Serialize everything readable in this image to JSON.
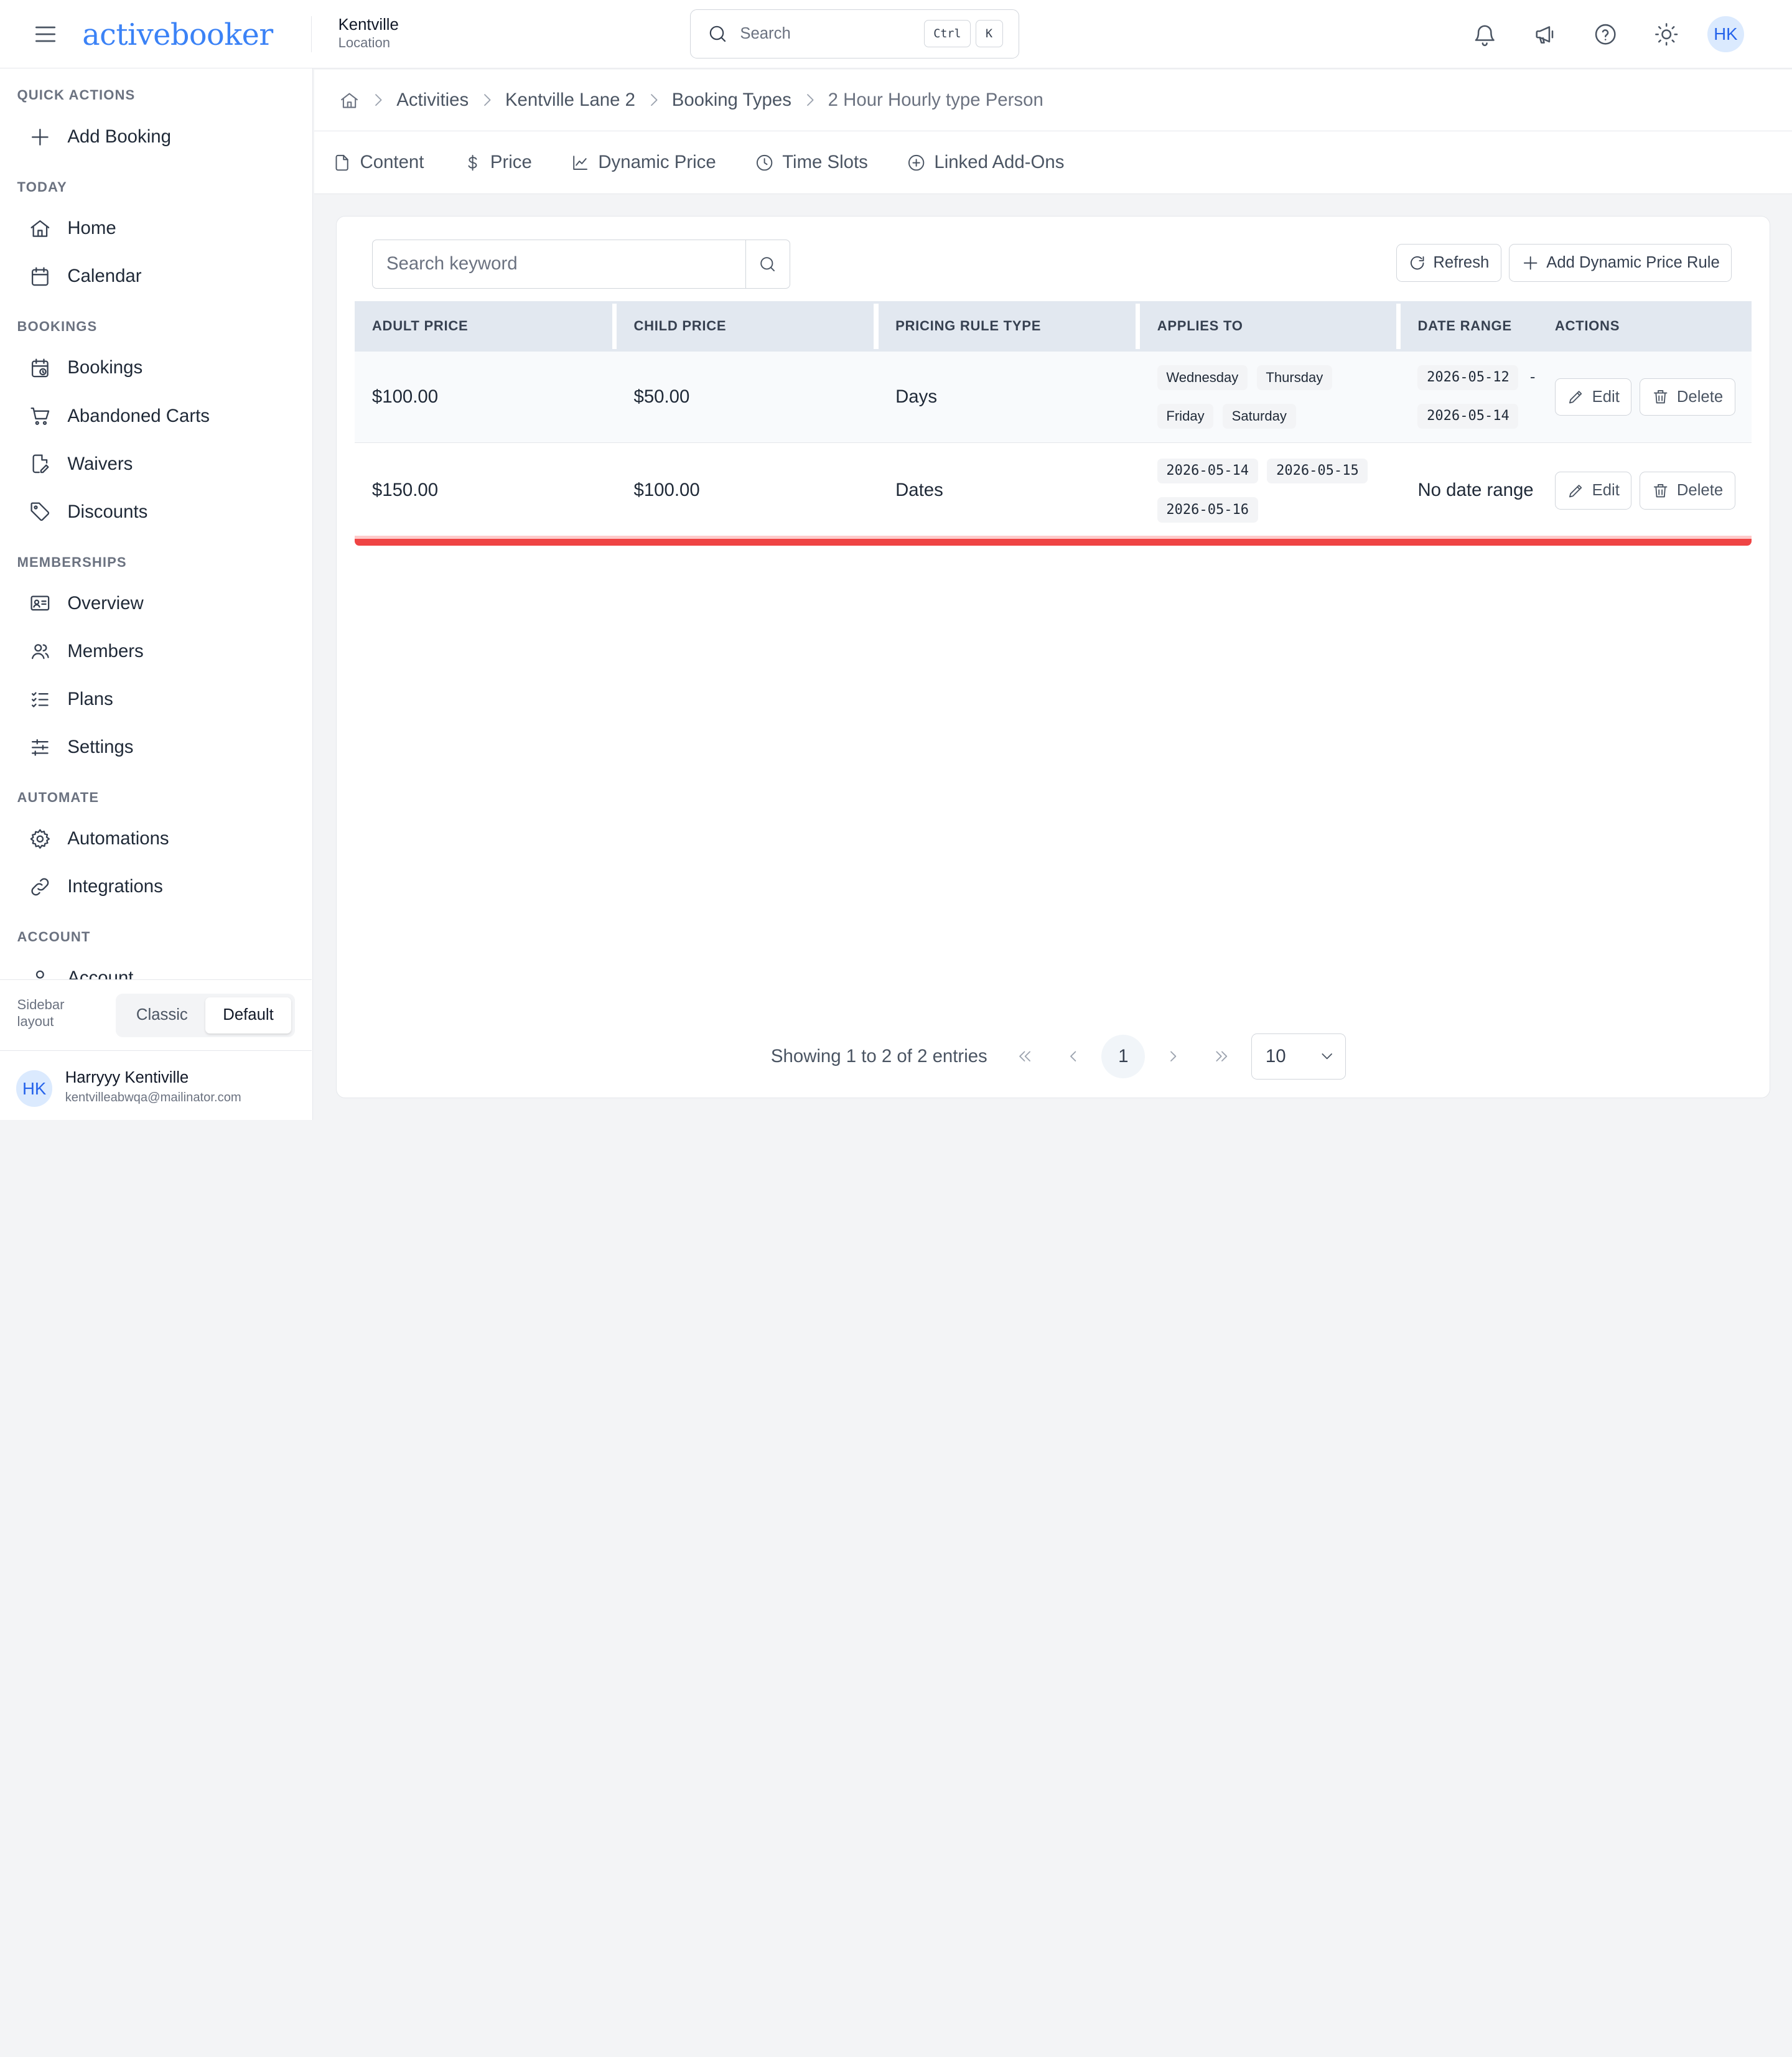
{
  "header": {
    "logo_text": "activebooker",
    "location_name": "Kentville",
    "location_sub": "Location",
    "search_placeholder": "Search",
    "kbd_ctrl": "Ctrl",
    "kbd_k": "K",
    "avatar_initials": "HK",
    "icons": [
      "bell-icon",
      "megaphone-icon",
      "help-icon",
      "sun-icon"
    ]
  },
  "sidebar": {
    "sections": {
      "quick_actions": "QUICK ACTIONS",
      "today": "TODAY",
      "bookings": "BOOKINGS",
      "memberships": "MEMBERSHIPS",
      "automate": "AUTOMATE",
      "account": "ACCOUNT"
    },
    "items": {
      "add_booking": "Add Booking",
      "home": "Home",
      "calendar": "Calendar",
      "bookings": "Bookings",
      "abandoned_carts": "Abandoned Carts",
      "waivers": "Waivers",
      "discounts": "Discounts",
      "overview": "Overview",
      "members": "Members",
      "plans": "Plans",
      "settings": "Settings",
      "automations": "Automations",
      "integrations": "Integrations",
      "account": "Account"
    },
    "layout_label": "Sidebar layout",
    "layout_options": [
      "Classic",
      "Default"
    ],
    "layout_selected": "Default",
    "user": {
      "initials": "HK",
      "name": "Harryyy Kentiville",
      "email": "kentvilleabwqa@mailinator.com"
    }
  },
  "breadcrumb": [
    "Activities",
    "Kentville Lane 2",
    "Booking Types",
    "2 Hour Hourly type Person"
  ],
  "tabs": [
    "Content",
    "Price",
    "Dynamic Price",
    "Time Slots",
    "Linked Add-Ons"
  ],
  "toolbar": {
    "search_placeholder": "Search keyword",
    "refresh": "Refresh",
    "add_rule": "Add Dynamic Price Rule"
  },
  "table": {
    "columns": [
      "ADULT PRICE",
      "CHILD PRICE",
      "PRICING RULE TYPE",
      "APPLIES TO",
      "DATE RANGE",
      "ACTIONS"
    ],
    "rows": [
      {
        "adult_price": "$100.00",
        "child_price": "$50.00",
        "rule_type": "Days",
        "applies_to": [
          "Wednesday",
          "Thursday",
          "Friday",
          "Saturday"
        ],
        "date_start": "2026-05-12",
        "date_sep": "-",
        "date_end": "2026-05-14",
        "edit": "Edit",
        "delete": "Delete"
      },
      {
        "adult_price": "$150.00",
        "child_price": "$100.00",
        "rule_type": "Dates",
        "applies_to": [
          "2026-05-14",
          "2026-05-15",
          "2026-05-16"
        ],
        "date_range_text": "No date range",
        "edit": "Edit",
        "delete": "Delete"
      }
    ]
  },
  "pagination": {
    "summary": "Showing 1 to 2 of 2 entries",
    "current_page": "1",
    "page_size": "10"
  },
  "colors": {
    "brand": "#3b82f6",
    "header_row": "#e2e8f0",
    "accent_red": "#ef4444"
  }
}
